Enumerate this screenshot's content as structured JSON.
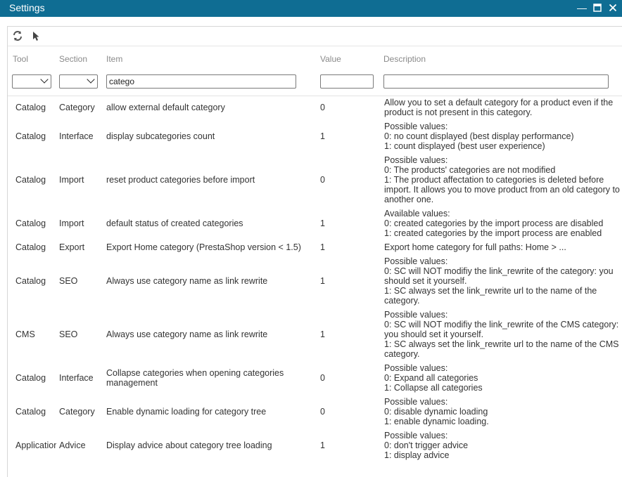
{
  "window": {
    "title": "Settings"
  },
  "columns": {
    "tool": "Tool",
    "section": "Section",
    "item": "Item",
    "value": "Value",
    "description": "Description"
  },
  "filters": {
    "tool": "",
    "section": "",
    "item": "catego",
    "value": "",
    "description": ""
  },
  "rows": [
    {
      "tool": "Catalog",
      "section": "Category",
      "item": "allow external default category",
      "value": "0",
      "description": "Allow you to set a default category for a product even if the\nproduct is not present in this category."
    },
    {
      "tool": "Catalog",
      "section": "Interface",
      "item": "display subcategories count",
      "value": "1",
      "description": "Possible values:\n0: no count displayed (best display performance)\n1: count displayed (best user experience)"
    },
    {
      "tool": "Catalog",
      "section": "Import",
      "item": "reset product categories before import",
      "value": "0",
      "description": "Possible values:\n0: The products' categories are not modified\n1: The product affectation to categories is deleted before\nimport. It allows you to move product from an old category to\nanother one."
    },
    {
      "tool": "Catalog",
      "section": "Import",
      "item": "default status of created categories",
      "value": "1",
      "description": "Available values:\n0: created categories by the import process are disabled\n1: created categories by the import process are enabled"
    },
    {
      "tool": "Catalog",
      "section": "Export",
      "item": "Export Home category (PrestaShop version < 1.5)",
      "value": "1",
      "description": "Export home category for full paths: Home > ..."
    },
    {
      "tool": "Catalog",
      "section": "SEO",
      "item": "Always use category name as link rewrite",
      "value": "1",
      "description": "Possible values:\n0: SC will NOT modifiy the link_rewrite of the category: you\nshould set it yourself.\n1: SC always set the link_rewrite url to the name of the\ncategory."
    },
    {
      "tool": "CMS",
      "section": "SEO",
      "item": "Always use category name as link rewrite",
      "value": "1",
      "description": "Possible values:\n0: SC will NOT modifiy the link_rewrite of the CMS category:\nyou should set it yourself.\n1: SC always set the link_rewrite url to the name of the CMS\ncategory."
    },
    {
      "tool": "Catalog",
      "section": "Interface",
      "item": "Collapse categories when opening categories\nmanagement",
      "value": "0",
      "description": "Possible values:\n0: Expand all categories\n1: Collapse all categories"
    },
    {
      "tool": "Catalog",
      "section": "Category",
      "item": "Enable dynamic loading for category tree",
      "value": "0",
      "description": "Possible values:\n0: disable dynamic loading\n1: enable dynamic loading."
    },
    {
      "tool": "Application",
      "section": "Advice",
      "item": "Display advice about category tree loading",
      "value": "1",
      "description": "Possible values:\n0: don't trigger advice\n1: display advice"
    }
  ]
}
